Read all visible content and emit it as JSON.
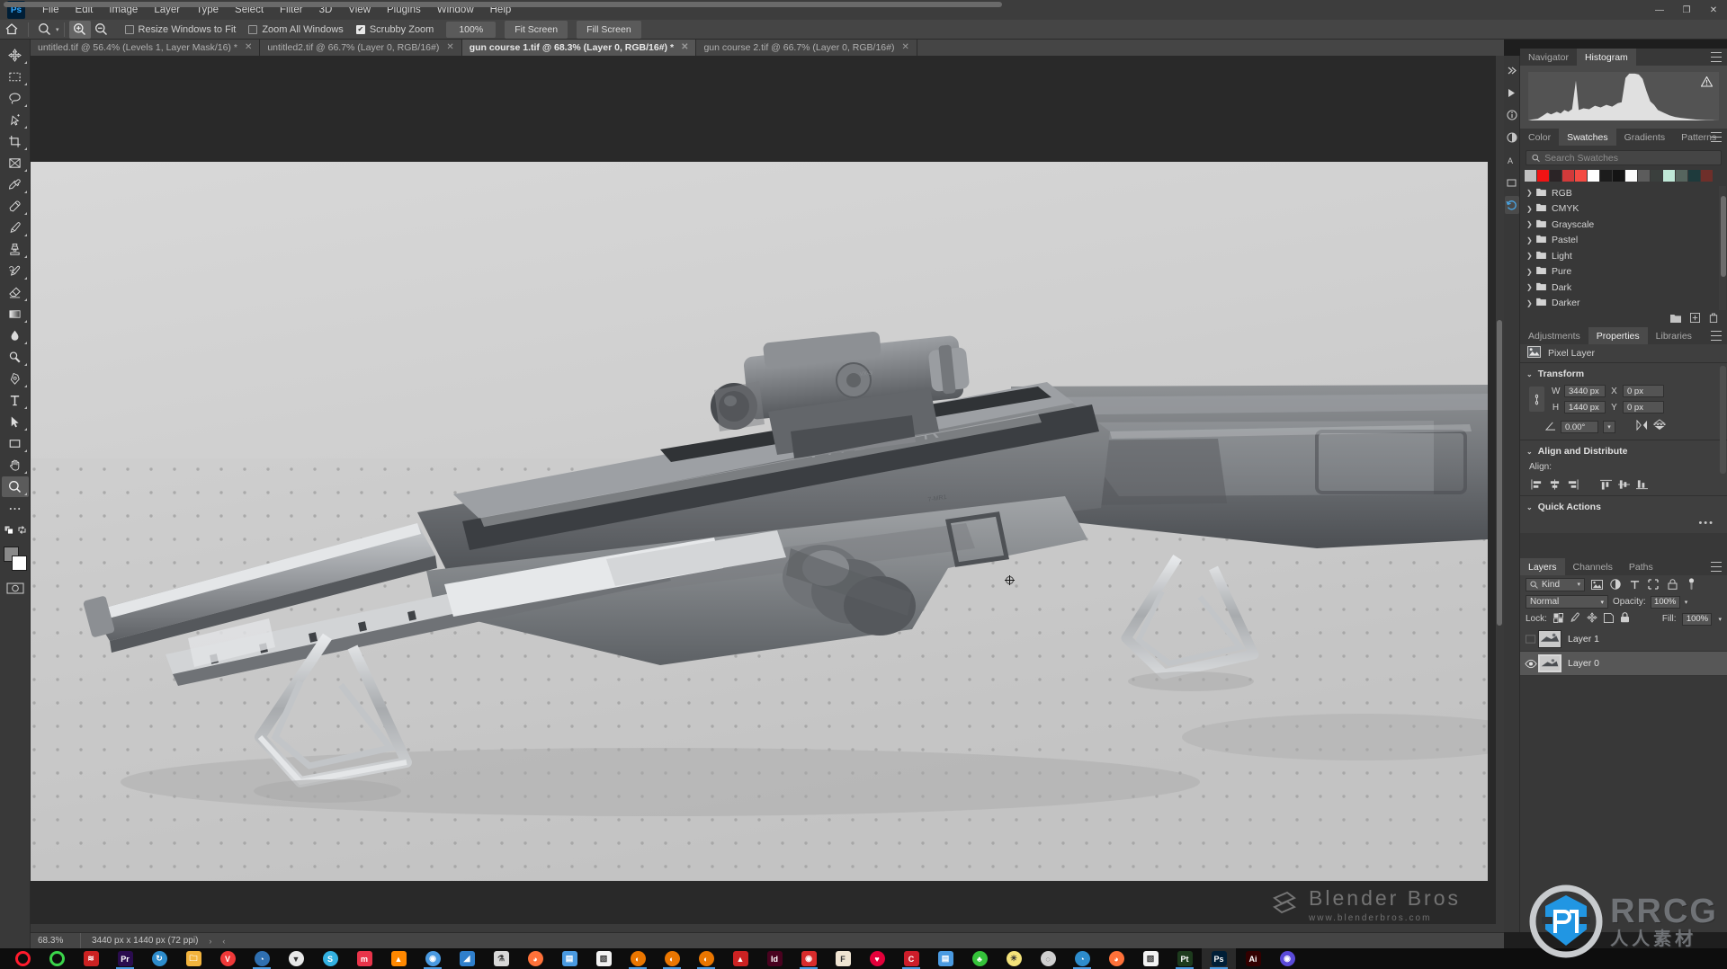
{
  "app": {
    "name": "Adobe Photoshop",
    "logo_text": "Ps"
  },
  "menubar": {
    "items": [
      {
        "label": "File"
      },
      {
        "label": "Edit"
      },
      {
        "label": "Image"
      },
      {
        "label": "Layer"
      },
      {
        "label": "Type"
      },
      {
        "label": "Select"
      },
      {
        "label": "Filter"
      },
      {
        "label": "3D"
      },
      {
        "label": "View"
      },
      {
        "label": "Plugins"
      },
      {
        "label": "Window"
      },
      {
        "label": "Help"
      }
    ],
    "window_controls": {
      "minimize": "—",
      "restore": "❐",
      "close": "✕"
    }
  },
  "options_bar": {
    "home_icon": "home-icon",
    "tool_icon": "zoom-tool-icon",
    "zoom_in_icon": "zoom-in-icon",
    "zoom_out_icon": "zoom-out-icon",
    "resize_windows_label": "Resize Windows to Fit",
    "resize_windows_checked": false,
    "zoom_all_label": "Zoom All Windows",
    "zoom_all_checked": false,
    "scrubby_label": "Scrubby Zoom",
    "scrubby_checked": true,
    "zoom_value": "100%",
    "fit_screen_label": "Fit Screen",
    "fill_screen_label": "Fill Screen"
  },
  "toolbar": {
    "tools": [
      {
        "name": "move-tool",
        "title": "Move Tool"
      },
      {
        "name": "rectangular-marquee-tool",
        "title": "Rectangular Marquee Tool"
      },
      {
        "name": "lasso-tool",
        "title": "Lasso Tool"
      },
      {
        "name": "object-selection-tool",
        "title": "Object Selection Tool"
      },
      {
        "name": "crop-tool",
        "title": "Crop Tool"
      },
      {
        "name": "frame-tool",
        "title": "Frame Tool"
      },
      {
        "name": "eyedropper-tool",
        "title": "Eyedropper Tool"
      },
      {
        "name": "spot-healing-brush-tool",
        "title": "Spot Healing Brush Tool"
      },
      {
        "name": "brush-tool",
        "title": "Brush Tool"
      },
      {
        "name": "clone-stamp-tool",
        "title": "Clone Stamp Tool"
      },
      {
        "name": "history-brush-tool",
        "title": "History Brush Tool"
      },
      {
        "name": "eraser-tool",
        "title": "Eraser Tool"
      },
      {
        "name": "gradient-tool",
        "title": "Gradient Tool"
      },
      {
        "name": "blur-tool",
        "title": "Blur Tool"
      },
      {
        "name": "dodge-tool",
        "title": "Dodge Tool"
      },
      {
        "name": "pen-tool",
        "title": "Pen Tool"
      },
      {
        "name": "type-tool",
        "title": "Horizontal Type Tool"
      },
      {
        "name": "path-selection-tool",
        "title": "Path Selection Tool"
      },
      {
        "name": "rectangle-tool",
        "title": "Rectangle Tool"
      },
      {
        "name": "hand-tool",
        "title": "Hand Tool"
      },
      {
        "name": "zoom-tool",
        "title": "Zoom Tool",
        "active": true
      },
      {
        "name": "edit-toolbar-tool",
        "title": "Edit Toolbar"
      }
    ],
    "foreground_color": "#8a8a8a",
    "background_color": "#ffffff",
    "quick_mask_label": "quick-mask-icon"
  },
  "document_tabs": [
    {
      "label": "untitled.tif @ 56.4% (Levels 1, Layer Mask/16) *",
      "active": false,
      "close": "✕"
    },
    {
      "label": "untitled2.tif @ 66.7% (Layer 0, RGB/16#)",
      "active": false,
      "close": "✕"
    },
    {
      "label": "gun course 1.tif @ 68.3% (Layer 0, RGB/16#) *",
      "active": true,
      "close": "✕"
    },
    {
      "label": "gun course 2.tif @ 66.7% (Layer 0, RGB/16#)",
      "active": false,
      "close": "✕"
    }
  ],
  "canvas": {
    "artwork_label": "VALKYR",
    "watermark_main": "Blender Bros",
    "watermark_sub": "www.blenderbros.com",
    "rrcg_main": "RRCG",
    "rrcg_sub": "人人素材"
  },
  "right_rail": [
    {
      "name": "expand-panels-icon",
      "glyph": "»"
    },
    {
      "name": "color-libraries-icon",
      "glyph": "▶"
    },
    {
      "name": "info-icon",
      "glyph": "ⓘ"
    },
    {
      "name": "adjustments-icon",
      "glyph": "◧"
    },
    {
      "name": "glyphs-icon",
      "glyph": "A"
    },
    {
      "name": "notes-icon",
      "glyph": "▭"
    },
    {
      "name": "history-icon",
      "glyph": "↺"
    }
  ],
  "histogram_panel": {
    "tabs": [
      {
        "label": "Navigator",
        "active": false
      },
      {
        "label": "Histogram",
        "active": true
      }
    ],
    "warning_icon": "cached-data-warning-icon"
  },
  "swatches_panel": {
    "tabs": [
      {
        "label": "Color",
        "active": false
      },
      {
        "label": "Swatches",
        "active": true
      },
      {
        "label": "Gradients",
        "active": false
      },
      {
        "label": "Patterns",
        "active": false
      }
    ],
    "search_placeholder": "Search Swatches",
    "search_value": "",
    "chips": [
      "#c0c0c0",
      "#f11414",
      "#2b2426",
      "#d13a3a",
      "#f44b43",
      "#ffffff",
      "#1c1c1c",
      "#141414",
      "#fbfbfb",
      "#5c5c5c",
      "#3a3f3d",
      "#bfe8d7",
      "#56655e",
      "#1e3a3c",
      "#6e2f2a"
    ],
    "folders": [
      {
        "label": "RGB"
      },
      {
        "label": "CMYK"
      },
      {
        "label": "Grayscale"
      },
      {
        "label": "Pastel"
      },
      {
        "label": "Light"
      },
      {
        "label": "Pure"
      },
      {
        "label": "Dark"
      },
      {
        "label": "Darker"
      }
    ],
    "footer_icons": [
      {
        "name": "new-swatch-group-icon"
      },
      {
        "name": "new-swatch-icon"
      },
      {
        "name": "delete-swatch-icon"
      }
    ]
  },
  "properties_panel": {
    "tabs": [
      {
        "label": "Adjustments",
        "active": false
      },
      {
        "label": "Properties",
        "active": true
      },
      {
        "label": "Libraries",
        "active": false
      }
    ],
    "layer_kind": "Pixel Layer",
    "transform": {
      "section_title": "Transform",
      "w_label": "W",
      "w_value": "3440 px",
      "h_label": "H",
      "h_value": "1440 px",
      "x_label": "X",
      "x_value": "0 px",
      "y_label": "Y",
      "y_value": "0 px",
      "angle_value": "0.00°",
      "link_icon": "link-wh-icon",
      "flip_h_icon": "flip-horizontal-icon",
      "flip_v_icon": "flip-vertical-icon"
    },
    "align": {
      "section_title": "Align and Distribute",
      "align_label": "Align:"
    },
    "quick_actions": {
      "section_title": "Quick Actions",
      "more": "•••"
    }
  },
  "layers_panel": {
    "tabs": [
      {
        "label": "Layers",
        "active": true
      },
      {
        "label": "Channels",
        "active": false
      },
      {
        "label": "Paths",
        "active": false
      }
    ],
    "kind_filter": "Kind",
    "filter_icons": [
      {
        "name": "filter-pixel-icon"
      },
      {
        "name": "filter-adjustment-icon"
      },
      {
        "name": "filter-type-icon"
      },
      {
        "name": "filter-shape-icon"
      },
      {
        "name": "filter-smart-object-icon"
      }
    ],
    "filter_toggle": "filter-enable-toggle",
    "blend_mode": "Normal",
    "opacity_label": "Opacity:",
    "opacity_value": "100%",
    "lock_label": "Lock:",
    "lock_icons": [
      {
        "name": "lock-transparent-pixels-icon"
      },
      {
        "name": "lock-image-pixels-icon"
      },
      {
        "name": "lock-position-icon"
      },
      {
        "name": "lock-artboard-nesting-icon"
      },
      {
        "name": "lock-all-icon"
      }
    ],
    "fill_label": "Fill:",
    "fill_value": "100%",
    "layers": [
      {
        "name": "Layer 1",
        "visible": false,
        "selected": false
      },
      {
        "name": "Layer 0",
        "visible": true,
        "selected": true
      }
    ]
  },
  "status_bar": {
    "zoom": "68.3%",
    "doc_info": "3440 px x 1440 px (72 ppi)",
    "arrow_right": "›",
    "arrow_left": "‹"
  },
  "taskbar": {
    "items": [
      {
        "name": "opera-icon",
        "glyph": "O",
        "color": "#ff1b2d",
        "shape": "ring",
        "running": false
      },
      {
        "name": "opera-gx-icon",
        "glyph": "",
        "color": "#3bd44a",
        "shape": "ring",
        "running": false
      },
      {
        "name": "substance-icon",
        "glyph": "≋",
        "color": "#cc2222",
        "shape": "sq",
        "running": false
      },
      {
        "name": "premiere-pro-icon",
        "glyph": "Pr",
        "color": "#2a0c4e",
        "shape": "sq",
        "running": true
      },
      {
        "name": "sync-icon",
        "glyph": "↻",
        "color": "#2d8ccc",
        "shape": "circ",
        "running": false
      },
      {
        "name": "file-explorer-icon",
        "glyph": "🗀",
        "color": "#f2b33d",
        "shape": "sq",
        "running": false
      },
      {
        "name": "vivaldi-icon",
        "glyph": "V",
        "color": "#ef3939",
        "shape": "circ",
        "running": false
      },
      {
        "name": "earth-browser-icon",
        "glyph": "◔",
        "color": "#2f6fb0",
        "shape": "circ",
        "running": true
      },
      {
        "name": "alienware-icon",
        "glyph": "▼",
        "color": "#e8e8e8",
        "shape": "circ",
        "running": false
      },
      {
        "name": "skype-icon",
        "glyph": "S",
        "color": "#33b1e1",
        "shape": "circ",
        "running": false
      },
      {
        "name": "marvelous-designer-icon",
        "glyph": "m",
        "color": "#e8344a",
        "shape": "sq",
        "running": false
      },
      {
        "name": "vlc-icon",
        "glyph": "▲",
        "color": "#ff8800",
        "shape": "sq",
        "running": false
      },
      {
        "name": "chrome-icon",
        "glyph": "◉",
        "color": "#4a9ae1",
        "shape": "circ",
        "running": true
      },
      {
        "name": "speaker-icon",
        "glyph": "◢",
        "color": "#2f7fcc",
        "shape": "sq",
        "running": false
      },
      {
        "name": "affinity-icon",
        "glyph": "⚗",
        "color": "#d8d8d8",
        "shape": "sq",
        "running": false
      },
      {
        "name": "firefox-dev-icon",
        "glyph": "◕",
        "color": "#ff7139",
        "shape": "circ",
        "running": false
      },
      {
        "name": "reader-icon",
        "glyph": "▤",
        "color": "#4a9ae1",
        "shape": "sq",
        "running": false
      },
      {
        "name": "notepad-icon",
        "glyph": "▧",
        "color": "#f2f2f2",
        "shape": "sq",
        "running": false
      },
      {
        "name": "blender-icon",
        "glyph": "◐",
        "color": "#ea7600",
        "shape": "circ",
        "running": true
      },
      {
        "name": "blender-icon-2",
        "glyph": "◐",
        "color": "#ea7600",
        "shape": "circ",
        "running": true
      },
      {
        "name": "blender-icon-3",
        "glyph": "◐",
        "color": "#ea7600",
        "shape": "circ",
        "running": true
      },
      {
        "name": "acrobat-icon",
        "glyph": "▲",
        "color": "#cc2222",
        "shape": "sq",
        "running": false
      },
      {
        "name": "indesign-icon",
        "glyph": "Id",
        "color": "#49021f",
        "shape": "sq",
        "running": false
      },
      {
        "name": "redshift-icon",
        "glyph": "◉",
        "color": "#d82c2c",
        "shape": "sq",
        "running": true
      },
      {
        "name": "fontbase-icon",
        "glyph": "F",
        "color": "#efe4d2",
        "shape": "sq",
        "running": false
      },
      {
        "name": "houdini-icon",
        "glyph": "♥",
        "color": "#e3003a",
        "shape": "circ",
        "running": false
      },
      {
        "name": "clip-studio-icon",
        "glyph": "C",
        "color": "#cc1d2a",
        "shape": "sq",
        "running": true
      },
      {
        "name": "explorer-win-icon",
        "glyph": "▤",
        "color": "#4a9ae1",
        "shape": "sq",
        "running": false
      },
      {
        "name": "tree-icon",
        "glyph": "♣",
        "color": "#35c23a",
        "shape": "circ",
        "running": false
      },
      {
        "name": "ideas-icon",
        "glyph": "☀",
        "color": "#f3e27a",
        "shape": "circ",
        "running": false
      },
      {
        "name": "spiral-icon",
        "glyph": "◌",
        "color": "#cfcfcf",
        "shape": "circ",
        "running": false
      },
      {
        "name": "edge-icon",
        "glyph": "◔",
        "color": "#2d8ccc",
        "shape": "circ",
        "running": true
      },
      {
        "name": "firefox-icon",
        "glyph": "◕",
        "color": "#ff7139",
        "shape": "circ",
        "running": false
      },
      {
        "name": "document-icon",
        "glyph": "▧",
        "color": "#f2f2f2",
        "shape": "sq",
        "running": false
      },
      {
        "name": "pt-icon",
        "glyph": "Pt",
        "color": "#1d3b1d",
        "shape": "sq",
        "running": true
      },
      {
        "name": "photoshop-icon",
        "glyph": "Ps",
        "color": "#001e36",
        "shape": "sq",
        "running": true,
        "active": true
      },
      {
        "name": "illustrator-icon",
        "glyph": "Ai",
        "color": "#330000",
        "shape": "sq",
        "running": false
      },
      {
        "name": "app-extra-icon",
        "glyph": "◉",
        "color": "#5a4ad8",
        "shape": "circ",
        "running": false
      }
    ]
  }
}
